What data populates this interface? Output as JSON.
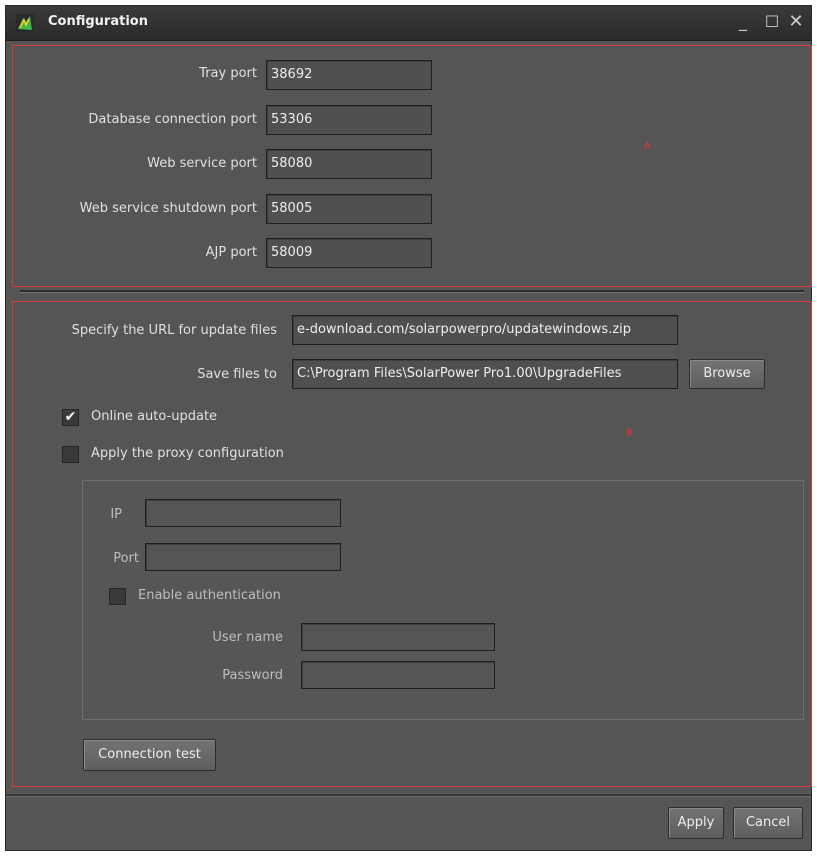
{
  "window": {
    "title": "Configuration",
    "minimize": "_",
    "maximize": "☐",
    "close": "✕"
  },
  "region_a": {
    "label": "A",
    "fields": [
      {
        "label": "Tray port",
        "value": "38692"
      },
      {
        "label": "Database connection port",
        "value": "53306"
      },
      {
        "label": "Web service port",
        "value": "58080"
      },
      {
        "label": "Web service shutdown port",
        "value": "58005"
      },
      {
        "label": "AJP port",
        "value": "58009"
      }
    ]
  },
  "region_b": {
    "label": "B",
    "update_url_label": "Specify the URL for update files",
    "update_url_value": "e-download.com/solarpowerpro/updatewindows.zip",
    "save_to_label": "Save files to",
    "save_to_value": "C:\\Program Files\\SolarPower Pro1.00\\UpgradeFiles",
    "browse_label": "Browse",
    "online_update_label": "Online auto-update",
    "online_update_checked": true,
    "proxy_label": "Apply the proxy configuration",
    "proxy_checked": false,
    "proxy": {
      "ip_label": "IP",
      "ip_value": "",
      "port_label": "Port",
      "port_value": "",
      "auth_label": "Enable authentication",
      "auth_checked": false,
      "username_label": "User name",
      "username_value": "",
      "password_label": "Password",
      "password_value": ""
    },
    "connection_test_label": "Connection test"
  },
  "footer": {
    "apply_label": "Apply",
    "cancel_label": "Cancel"
  },
  "colors": {
    "background": "#555555",
    "region_border": "#d43b3b"
  }
}
